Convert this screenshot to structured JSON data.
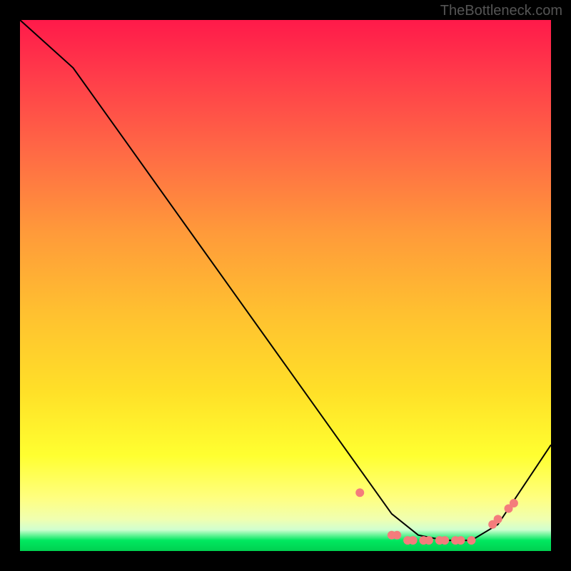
{
  "watermark": "TheBottleneck.com",
  "chart_data": {
    "type": "line",
    "title": "",
    "xlabel": "",
    "ylabel": "",
    "xlim": [
      0,
      100
    ],
    "ylim": [
      0,
      100
    ],
    "grid": false,
    "legend": false,
    "series": [
      {
        "name": "curve",
        "x": [
          0,
          10,
          20,
          30,
          40,
          50,
          60,
          65,
          70,
          75,
          80,
          85,
          90,
          100
        ],
        "y": [
          100,
          91,
          77,
          63,
          49,
          35,
          21,
          14,
          7,
          3,
          2,
          2,
          5,
          20
        ]
      }
    ],
    "markers": {
      "name": "dots",
      "x": [
        64,
        70,
        71,
        73,
        74,
        76,
        77,
        79,
        80,
        82,
        83,
        85,
        89,
        90,
        92,
        93
      ],
      "y": [
        11,
        3,
        3,
        2,
        2,
        2,
        2,
        2,
        2,
        2,
        2,
        2,
        5,
        6,
        8,
        9
      ],
      "color": "#f47c7c"
    }
  }
}
